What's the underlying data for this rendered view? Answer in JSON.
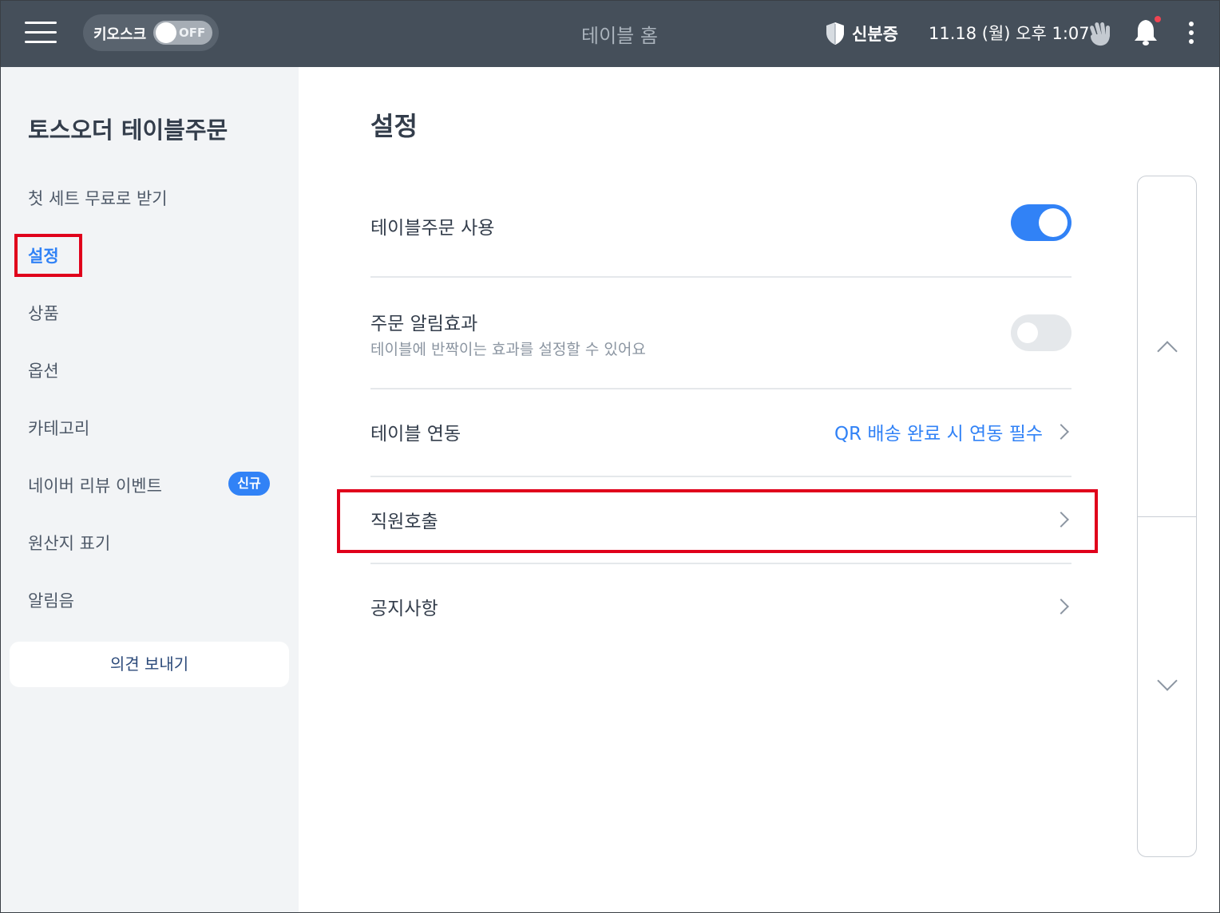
{
  "header": {
    "kiosk_label": "키오스크",
    "kiosk_state": "OFF",
    "title": "테이블 홈",
    "id_label": "신분증",
    "datetime": "11.18 (월) 오후 1:07"
  },
  "sidebar": {
    "brand": "토스오더 테이블주문",
    "items": [
      {
        "label": "첫 세트 무료로 받기"
      },
      {
        "label": "설정"
      },
      {
        "label": "상품"
      },
      {
        "label": "옵션"
      },
      {
        "label": "카테고리"
      },
      {
        "label": "네이버 리뷰 이벤트",
        "badge": "신규"
      },
      {
        "label": "원산지 표기"
      },
      {
        "label": "알림음"
      }
    ],
    "feedback": "의견 보내기"
  },
  "main": {
    "title": "설정",
    "rows": [
      {
        "title": "테이블주문 사용",
        "toggle": "on"
      },
      {
        "title": "주문 알림효과",
        "subtitle": "테이블에 반짝이는 효과를 설정할 수 있어요",
        "toggle": "off"
      },
      {
        "title": "테이블 연동",
        "value": "QR 배송 완료 시 연동 필수"
      },
      {
        "title": "직원호출"
      },
      {
        "title": "공지사항"
      }
    ]
  },
  "colors": {
    "header_bg": "#454f5a",
    "accent": "#3182f6",
    "highlight": "#e0001b",
    "sidebar_bg": "#f2f4f6"
  }
}
